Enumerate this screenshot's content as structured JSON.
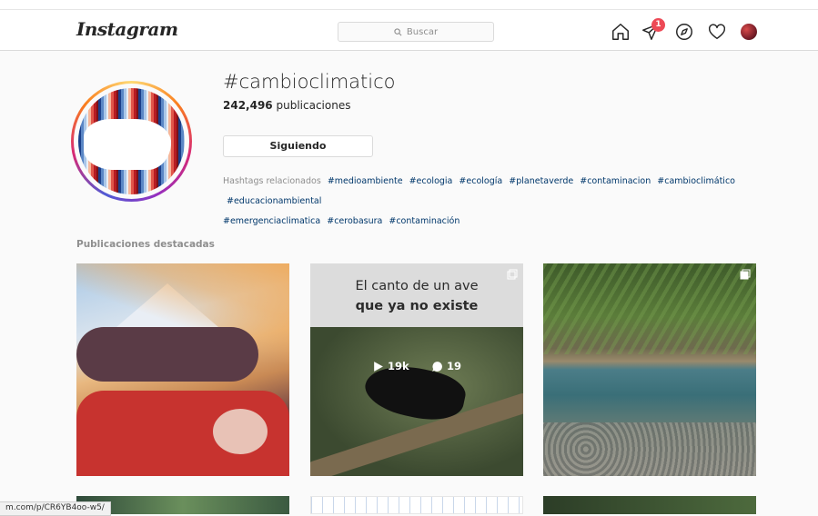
{
  "header": {
    "logo": "Instagram",
    "search_placeholder": "Buscar",
    "notification_count": "1",
    "icons": [
      "home-icon",
      "direct-icon",
      "explore-icon",
      "activity-heart-icon",
      "profile-avatar"
    ]
  },
  "tag": {
    "name": "#cambioclimatico",
    "post_count": "242,496",
    "post_count_label": "publicaciones",
    "follow_button": "Siguiendo",
    "related_label": "Hashtags relacionados",
    "related": [
      "#medioambiente",
      "#ecologia",
      "#ecología",
      "#planetaverde",
      "#contaminacion",
      "#cambioclimático",
      "#educacionambiental",
      "#emergenciaclimatica",
      "#cerobasura",
      "#contaminación"
    ]
  },
  "featured": {
    "title": "Publicaciones destacadas",
    "posts": [
      {
        "caption_line1": "",
        "caption_line2": ""
      },
      {
        "caption_line1": "El canto de un ave",
        "caption_line2": "que ya no existe",
        "likes": "19k",
        "comments": "19"
      },
      {
        "caption_line1": "",
        "caption_line2": ""
      }
    ]
  },
  "status_bar": {
    "url": "m.com/p/CR6YB4oo-w5/"
  },
  "colors": {
    "accent_badge": "#ed4956",
    "link": "#00376b",
    "border": "#dbdbdb"
  }
}
